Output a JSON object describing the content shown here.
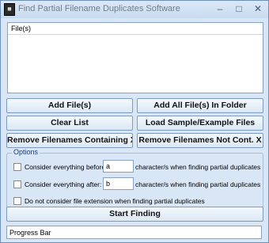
{
  "window": {
    "title": "Find Partial Filename Duplicates Software",
    "icon": "app-icon",
    "controls": [
      "minimize",
      "maximize",
      "close"
    ]
  },
  "file_list": {
    "header": "File(s)",
    "items": []
  },
  "buttons": {
    "add_files": "Add File(s)",
    "add_all_folder": "Add All File(s) In Folder",
    "clear_list": "Clear List",
    "load_sample": "Load Sample/Example Files",
    "remove_containing": "Remove Filenames Containing X",
    "remove_not_containing": "Remove Filenames Not Cont. X",
    "start_finding": "Start Finding"
  },
  "options": {
    "legend": "Options",
    "before": {
      "label": "Consider everything before:",
      "value": "a",
      "tail": "character/s when finding partial duplicates",
      "checked": false
    },
    "after": {
      "label": "Consider everything after:",
      "value": "b",
      "tail": "character/s when finding partial duplicates",
      "checked": false
    },
    "ignore_ext": {
      "label": "Do not consider file extension when finding partial duplicates",
      "checked": false
    }
  },
  "progress": {
    "label": "Progress Bar"
  }
}
